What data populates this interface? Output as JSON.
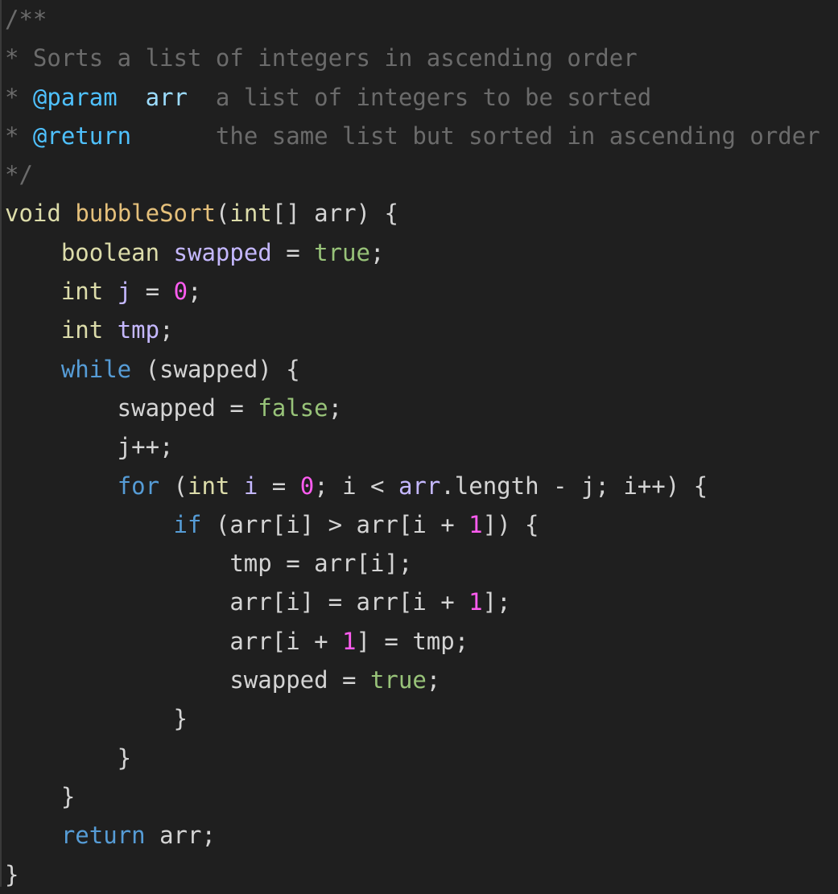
{
  "editor": {
    "language": "java",
    "colors": {
      "background": "#1f1f1f",
      "comment": "#6b6b6b",
      "doc_tag": "#4fc1ff",
      "keyword": "#569cd6",
      "type": "#dcdcaa",
      "function": "#e5c07b",
      "variable": "#c5b8ff",
      "literal": "#98c379",
      "number": "#ff5cf0",
      "plain": "#d4d4d4"
    },
    "lines": [
      [
        {
          "t": "/**",
          "c": "comment"
        }
      ],
      [
        {
          "t": "* Sorts a list of integers in ascending order",
          "c": "comment"
        }
      ],
      [
        {
          "t": "* ",
          "c": "comment"
        },
        {
          "t": "@param",
          "c": "doctag"
        },
        {
          "t": "  ",
          "c": "comment"
        },
        {
          "t": "arr",
          "c": "docname"
        },
        {
          "t": "  a list of integers to be sorted",
          "c": "comment"
        }
      ],
      [
        {
          "t": "* ",
          "c": "comment"
        },
        {
          "t": "@return",
          "c": "doctag"
        },
        {
          "t": "      the same list but sorted in ascending order",
          "c": "comment"
        }
      ],
      [
        {
          "t": "*/",
          "c": "comment"
        }
      ],
      [
        {
          "t": "void",
          "c": "type"
        },
        {
          "t": " ",
          "c": "plain"
        },
        {
          "t": "bubbleSort",
          "c": "func"
        },
        {
          "t": "(",
          "c": "plain"
        },
        {
          "t": "int",
          "c": "type"
        },
        {
          "t": "[] arr) {",
          "c": "plain"
        }
      ],
      [
        {
          "t": "    ",
          "c": "plain"
        },
        {
          "t": "boolean",
          "c": "type"
        },
        {
          "t": " ",
          "c": "plain"
        },
        {
          "t": "swapped",
          "c": "var"
        },
        {
          "t": " = ",
          "c": "plain"
        },
        {
          "t": "true",
          "c": "lit"
        },
        {
          "t": ";",
          "c": "plain"
        }
      ],
      [
        {
          "t": "    ",
          "c": "plain"
        },
        {
          "t": "int",
          "c": "type"
        },
        {
          "t": " ",
          "c": "plain"
        },
        {
          "t": "j",
          "c": "var"
        },
        {
          "t": " = ",
          "c": "plain"
        },
        {
          "t": "0",
          "c": "num"
        },
        {
          "t": ";",
          "c": "plain"
        }
      ],
      [
        {
          "t": "    ",
          "c": "plain"
        },
        {
          "t": "int",
          "c": "type"
        },
        {
          "t": " ",
          "c": "plain"
        },
        {
          "t": "tmp",
          "c": "var"
        },
        {
          "t": ";",
          "c": "plain"
        }
      ],
      [
        {
          "t": "    ",
          "c": "plain"
        },
        {
          "t": "while",
          "c": "kw"
        },
        {
          "t": " (swapped) {",
          "c": "plain"
        }
      ],
      [
        {
          "t": "        swapped = ",
          "c": "plain"
        },
        {
          "t": "false",
          "c": "lit"
        },
        {
          "t": ";",
          "c": "plain"
        }
      ],
      [
        {
          "t": "        j++;",
          "c": "plain"
        }
      ],
      [
        {
          "t": "        ",
          "c": "plain"
        },
        {
          "t": "for",
          "c": "kw"
        },
        {
          "t": " (",
          "c": "plain"
        },
        {
          "t": "int",
          "c": "type"
        },
        {
          "t": " ",
          "c": "plain"
        },
        {
          "t": "i",
          "c": "var"
        },
        {
          "t": " = ",
          "c": "plain"
        },
        {
          "t": "0",
          "c": "num"
        },
        {
          "t": "; i < ",
          "c": "plain"
        },
        {
          "t": "arr",
          "c": "var"
        },
        {
          "t": ".length - j; i++) {",
          "c": "plain"
        }
      ],
      [
        {
          "t": "            ",
          "c": "plain"
        },
        {
          "t": "if",
          "c": "kw"
        },
        {
          "t": " (arr[i] > arr[i + ",
          "c": "plain"
        },
        {
          "t": "1",
          "c": "num"
        },
        {
          "t": "]) {",
          "c": "plain"
        }
      ],
      [
        {
          "t": "                tmp = arr[i];",
          "c": "plain"
        }
      ],
      [
        {
          "t": "                arr[i] = arr[i + ",
          "c": "plain"
        },
        {
          "t": "1",
          "c": "num"
        },
        {
          "t": "];",
          "c": "plain"
        }
      ],
      [
        {
          "t": "                arr[i + ",
          "c": "plain"
        },
        {
          "t": "1",
          "c": "num"
        },
        {
          "t": "] = tmp;",
          "c": "plain"
        }
      ],
      [
        {
          "t": "                swapped = ",
          "c": "plain"
        },
        {
          "t": "true",
          "c": "lit"
        },
        {
          "t": ";",
          "c": "plain"
        }
      ],
      [
        {
          "t": "            }",
          "c": "plain"
        }
      ],
      [
        {
          "t": "        }",
          "c": "plain"
        }
      ],
      [
        {
          "t": "    }",
          "c": "plain"
        }
      ],
      [
        {
          "t": "    ",
          "c": "plain"
        },
        {
          "t": "return",
          "c": "kw"
        },
        {
          "t": " arr;",
          "c": "plain"
        }
      ],
      [
        {
          "t": "}",
          "c": "plain"
        }
      ]
    ]
  }
}
